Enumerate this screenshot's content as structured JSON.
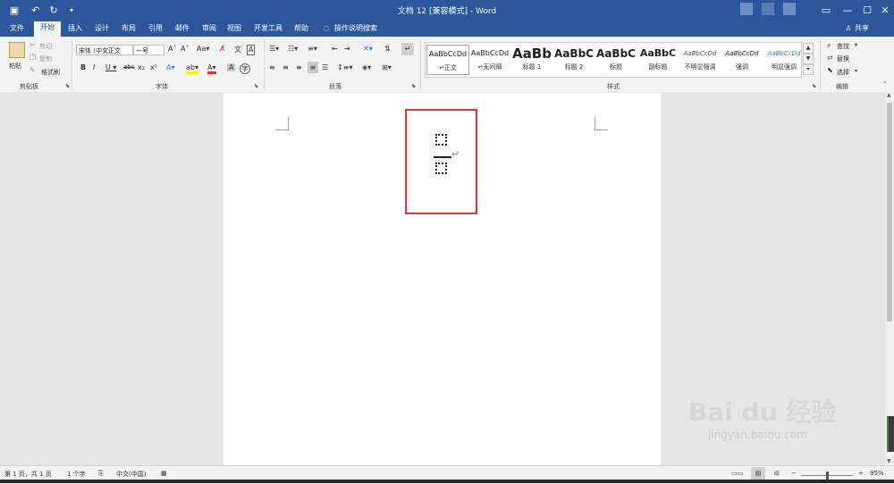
{
  "window": {
    "title": "文档 12 [兼容模式] - Word"
  },
  "tabs": [
    {
      "label": "文件"
    },
    {
      "label": "开始"
    },
    {
      "label": "插入"
    },
    {
      "label": "设计"
    },
    {
      "label": "布局"
    },
    {
      "label": "引用"
    },
    {
      "label": "邮件"
    },
    {
      "label": "审阅"
    },
    {
      "label": "视图"
    },
    {
      "label": "开发工具"
    },
    {
      "label": "帮助"
    }
  ],
  "tell_me": "操作说明搜索",
  "share": "共享",
  "clipboard": {
    "paste": "粘贴",
    "cut": "剪切",
    "copy": "复制",
    "format_painter": "格式刷",
    "group": "剪贴板"
  },
  "font": {
    "name": "宋体 (中文正文",
    "size": "一号",
    "group": "字体"
  },
  "paragraph": {
    "group": "段落"
  },
  "styles": {
    "group": "样式",
    "items": [
      {
        "preview": "AaBbCcDd",
        "name": "↵正文"
      },
      {
        "preview": "AaBbCcDd",
        "name": "↵无间隔"
      },
      {
        "preview": "AaBb",
        "name": "标题 1"
      },
      {
        "preview": "AaBbC",
        "name": "标题 2"
      },
      {
        "preview": "AaBbC",
        "name": "标题"
      },
      {
        "preview": "AaBbC",
        "name": "副标题"
      },
      {
        "preview": "AaBbCcDd",
        "name": "不明显强调"
      },
      {
        "preview": "AaBbCcDd",
        "name": "强调"
      },
      {
        "preview": "AaBbCcDd",
        "name": "明显强调"
      }
    ]
  },
  "editing": {
    "find": "查找",
    "replace": "替换",
    "select": "选择",
    "group": "编辑"
  },
  "status": {
    "page": "第 1 页，共 1 页",
    "words": "1 个字",
    "language": "中文(中国)",
    "zoom": "95%"
  },
  "watermark": {
    "brand": "Bai du 经验",
    "url": "jingyan.baidu.com"
  },
  "colors": {
    "accent": "#2b579a",
    "highlight_box": "#e0373b"
  }
}
